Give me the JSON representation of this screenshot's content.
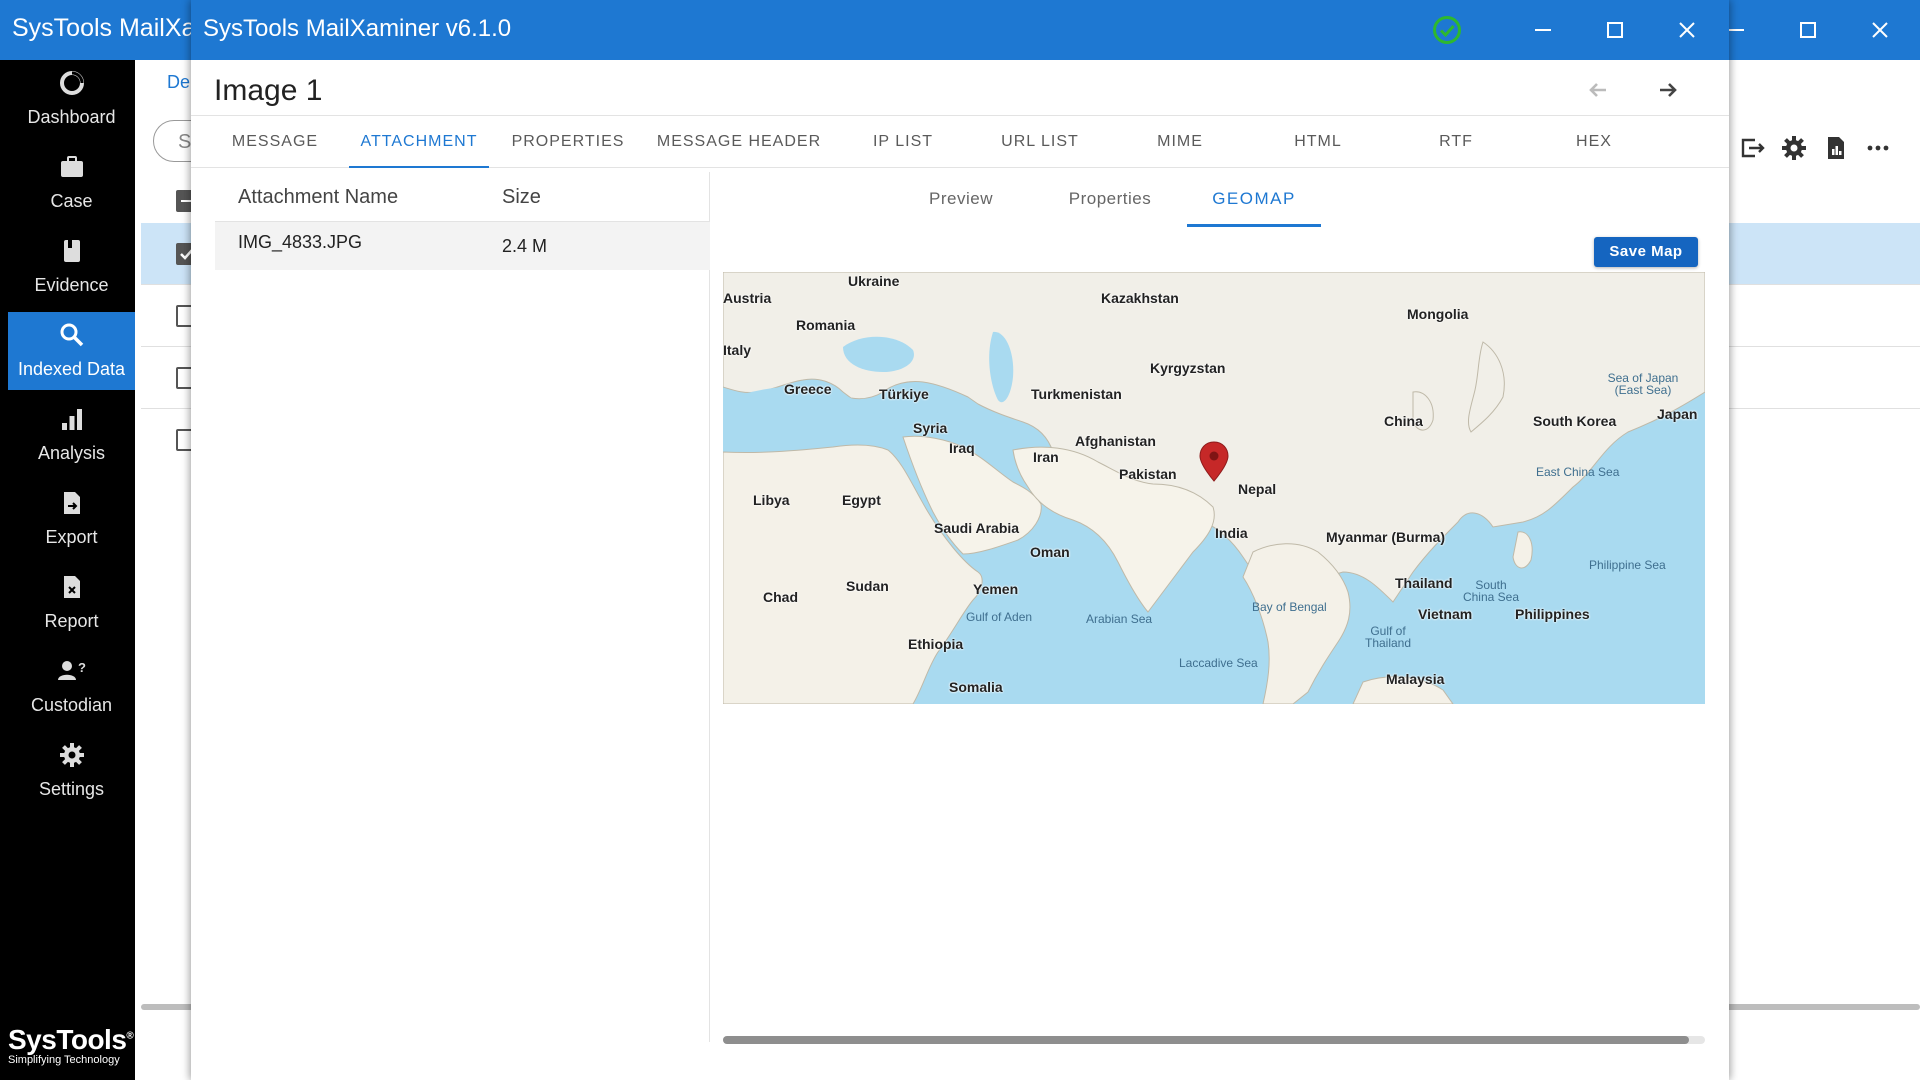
{
  "main_window": {
    "title": "SysTools MailXa",
    "breadcrumb": "De",
    "search_placeholder": "S"
  },
  "sidebar": {
    "items": [
      {
        "label": "Dashboard",
        "icon": "dashboard-icon"
      },
      {
        "label": "Case",
        "icon": "briefcase-icon"
      },
      {
        "label": "Evidence",
        "icon": "evidence-icon"
      },
      {
        "label": "Indexed Data",
        "icon": "search-icon",
        "active": true
      },
      {
        "label": "Analysis",
        "icon": "analysis-icon"
      },
      {
        "label": "Export",
        "icon": "export-icon"
      },
      {
        "label": "Report",
        "icon": "report-icon"
      },
      {
        "label": "Custodian",
        "icon": "custodian-icon"
      },
      {
        "label": "Settings",
        "icon": "gear-icon"
      }
    ],
    "brand_name": "SysTools",
    "brand_mark": "®",
    "brand_tagline": "Simplifying Technology"
  },
  "dialog": {
    "title": "SysTools MailXaminer v6.1.0",
    "heading": "Image 1",
    "tabs": [
      "MESSAGE",
      "ATTACHMENT",
      "PROPERTIES",
      "MESSAGE HEADER",
      "IP LIST",
      "URL LIST",
      "MIME",
      "HTML",
      "RTF",
      "HEX"
    ],
    "active_tab": "ATTACHMENT",
    "attachments": {
      "headers": [
        "Attachment Name",
        "Size"
      ],
      "rows": [
        {
          "name": "IMG_4833.JPG",
          "size": "2.4 M"
        }
      ]
    },
    "subtabs": [
      "Preview",
      "Properties",
      "GEOMAP"
    ],
    "active_subtab": "GEOMAP",
    "save_map_label": "Save Map",
    "map": {
      "countries": [
        "Ukraine",
        "Kazakhstan",
        "Mongolia",
        "Austria",
        "Romania",
        "Italy",
        "Greece",
        "Türkiye",
        "Turkmenistan",
        "Kyrgyzstan",
        "China",
        "South Korea",
        "Japan",
        "Syria",
        "Iraq",
        "Iran",
        "Afghanistan",
        "Pakistan",
        "Nepal",
        "Libya",
        "Egypt",
        "Saudi Arabia",
        "India",
        "Myanmar (Burma)",
        "Oman",
        "Chad",
        "Sudan",
        "Yemen",
        "Thailand",
        "Vietnam",
        "Philippines",
        "Ethiopia",
        "Somalia",
        "Malaysia"
      ],
      "seas": [
        "Sea of Japan (East Sea)",
        "East China Sea",
        "Philippine Sea",
        "Gulf of Aden",
        "Arabian Sea",
        "Bay of Bengal",
        "South China Sea",
        "Gulf of Thailand",
        "Laccadive Sea"
      ],
      "pin": "India",
      "marker_color": "#c62828"
    }
  },
  "colors": {
    "accent": "#1e78d2",
    "sidebar_bg": "#000000",
    "selected_row": "#cce4f7",
    "status_ok": "#2eb82e"
  }
}
